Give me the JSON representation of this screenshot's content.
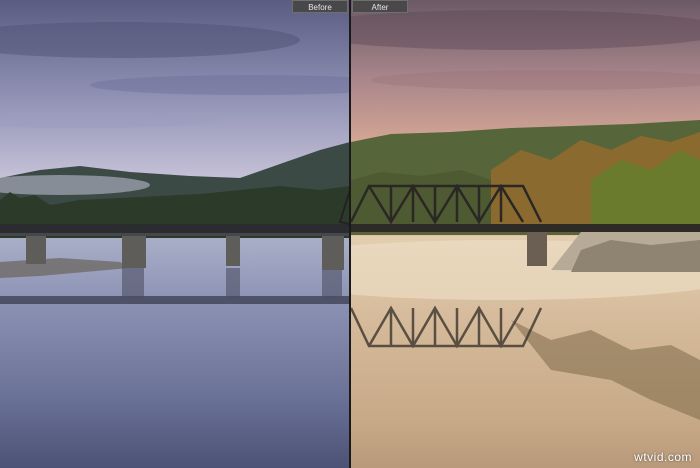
{
  "comparison": {
    "before_label": "Before",
    "after_label": "After"
  },
  "watermark": {
    "text": "wtvid.com"
  },
  "icons": [
    "bridge-photo"
  ],
  "colors": {
    "tab_bg": "#464646",
    "tab_text": "#e6e6e6",
    "divider": "#1a1a1a"
  }
}
